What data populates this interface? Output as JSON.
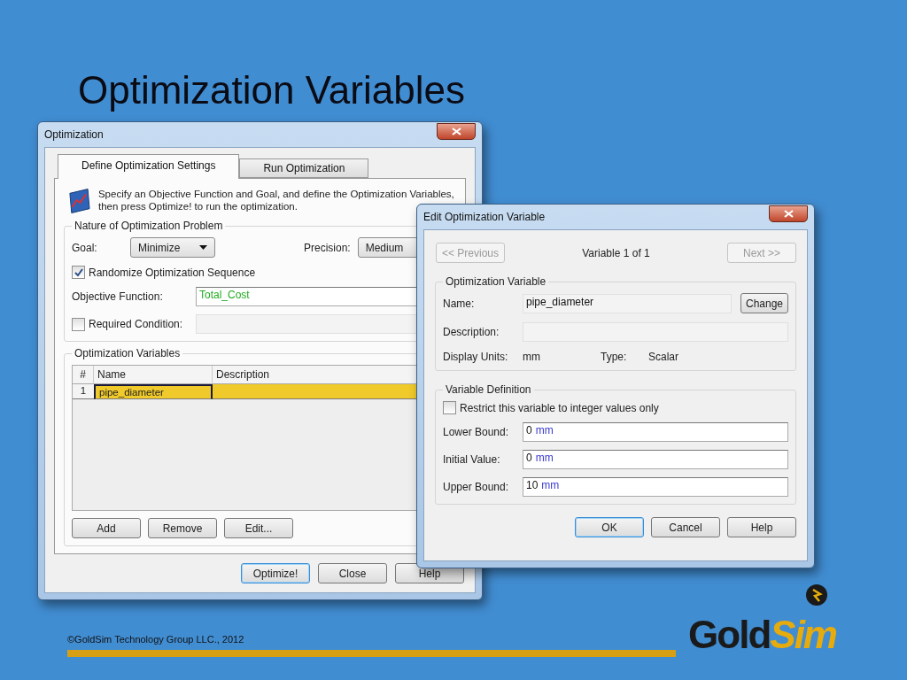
{
  "slide": {
    "title": "Optimization Variables",
    "footer": "©GoldSim Technology Group LLC., 2012",
    "logo": {
      "part_1": "Gold",
      "part_2": "Sim"
    }
  },
  "optimization_window": {
    "title": "Optimization",
    "tabs": [
      {
        "label": "Define Optimization Settings",
        "selected": true
      },
      {
        "label": "Run Optimization",
        "selected": false
      }
    ],
    "intro": "Specify an Objective Function and Goal, and define the Optimization Variables, then press Optimize! to run the optimization.",
    "nature_group": {
      "title": "Nature of Optimization Problem",
      "goal_label": "Goal:",
      "goal_value": "Minimize",
      "precision_label": "Precision:",
      "precision_value": "Medium",
      "randomize": {
        "label": "Randomize Optimization Sequence",
        "checked": true
      },
      "objective_label": "Objective Function:",
      "objective_value": "Total_Cost",
      "required": {
        "label": "Required Condition:",
        "checked": false
      }
    },
    "variables_group": {
      "title": "Optimization Variables",
      "columns": [
        "#",
        "Name",
        "Description"
      ],
      "rows": [
        {
          "index": "1",
          "name": "pipe_diameter",
          "selected": true
        }
      ],
      "buttons": [
        "Add",
        "Remove",
        "Edit..."
      ]
    },
    "footer_buttons": [
      {
        "label": "Optimize!",
        "default": true
      },
      {
        "label": "Close",
        "default": false
      },
      {
        "label": "Help",
        "default": false
      }
    ]
  },
  "edit_window": {
    "title": "Edit Optimization Variable",
    "previous": {
      "label": "<< Previous",
      "disabled": true
    },
    "counter": "Variable 1 of 1",
    "next": {
      "label": "Next >>",
      "disabled": true
    },
    "variable_group": {
      "title": "Optimization Variable",
      "name_label": "Name:",
      "name_value": "pipe_diameter",
      "change_button": "Change",
      "description_label": "Description:",
      "units_label": "Display Units:",
      "units_value": "mm",
      "type_label": "Type:",
      "type_value": "Scalar"
    },
    "definition_group": {
      "title": "Variable Definition",
      "restrict": {
        "label": "Restrict this variable to integer values only",
        "checked": false
      },
      "fields": [
        {
          "label": "Lower Bound:",
          "number": "0",
          "unit": "mm"
        },
        {
          "label": "Initial Value:",
          "number": "0",
          "unit": "mm"
        },
        {
          "label": "Upper Bound:",
          "number": "10",
          "unit": "mm"
        }
      ]
    },
    "buttons": [
      {
        "label": "OK",
        "default": true
      },
      {
        "label": "Cancel",
        "default": false
      },
      {
        "label": "Help",
        "default": false
      }
    ]
  }
}
